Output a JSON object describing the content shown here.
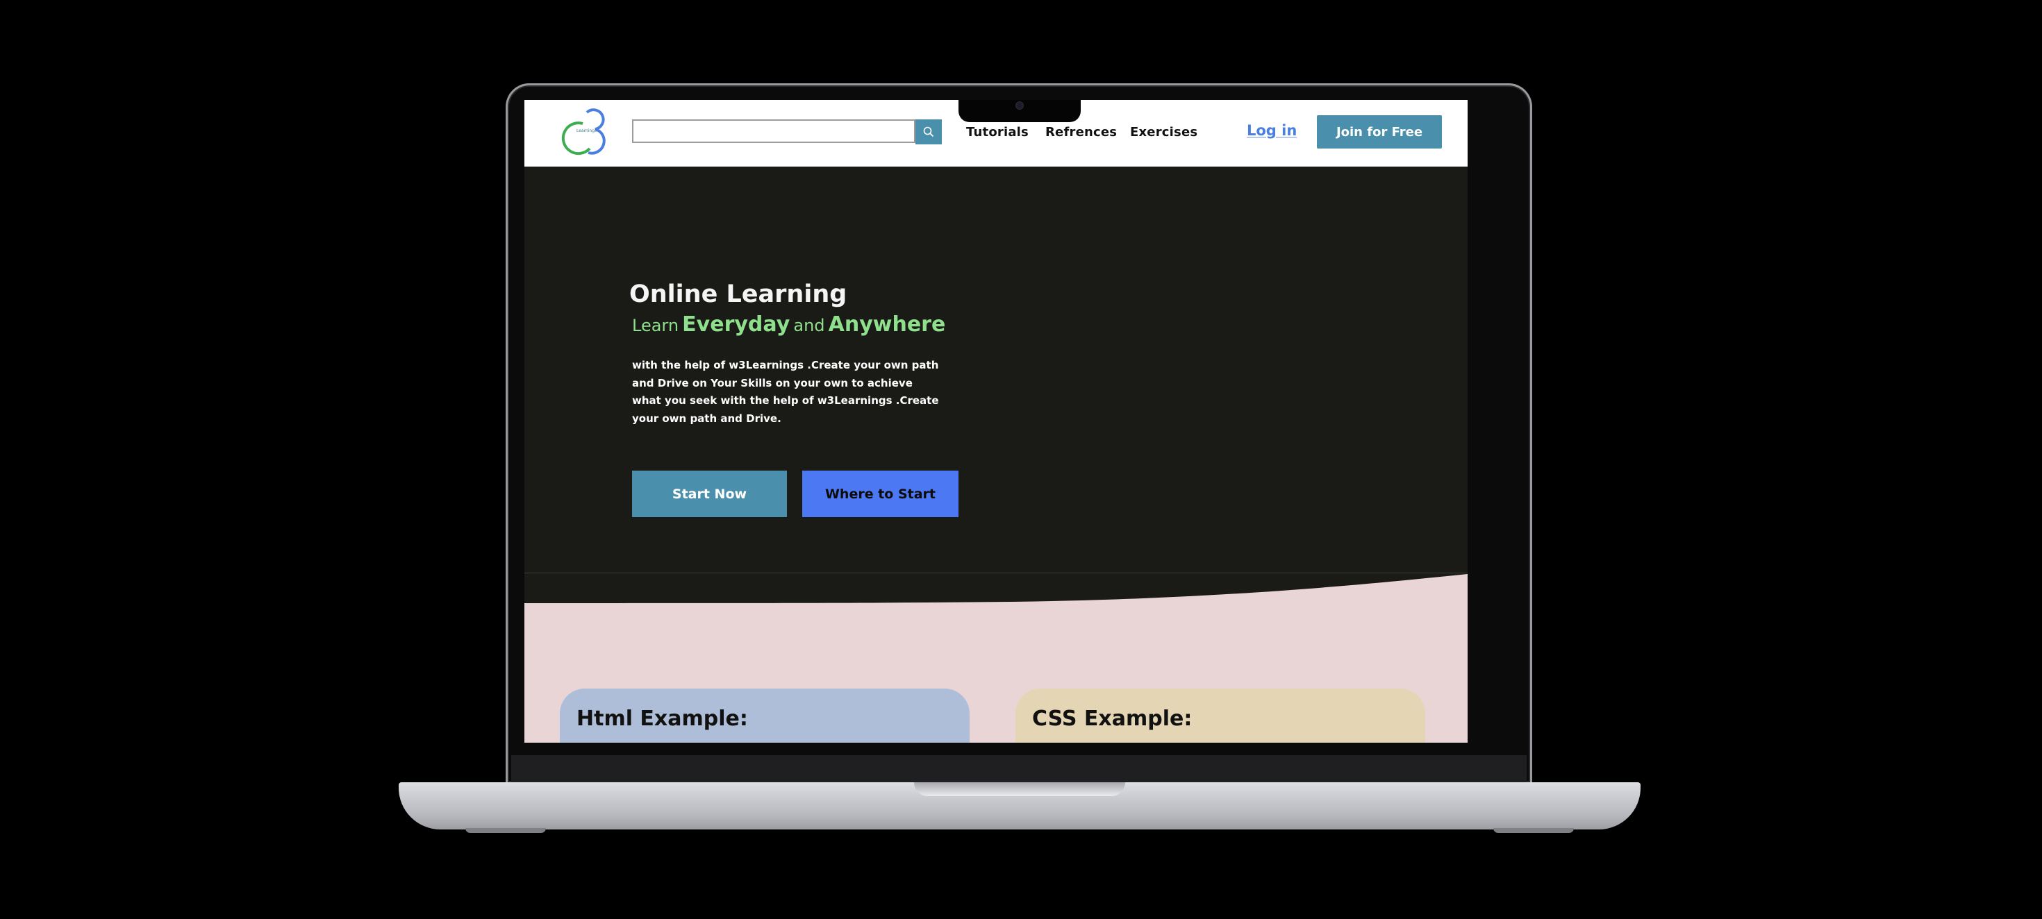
{
  "navbar": {
    "search": {
      "value": "",
      "placeholder": ""
    },
    "links": [
      "Tutorials",
      "Refrences",
      "Exercises"
    ],
    "login_label": "Log in",
    "join_label": "Join for Free"
  },
  "hero": {
    "title": "Online Learning",
    "tagline": {
      "learn": "Learn",
      "everyday": "Everyday",
      "and": "and",
      "anywhere": "Anywhere"
    },
    "description": "with the help of w3Learnings .Create your own path and Drive on Your Skills on your own to achieve what you seek with the help of w3Learnings .Create your own path and Drive.",
    "start_label": "Start Now",
    "where_label": "Where to Start"
  },
  "examples": [
    {
      "title": "Html Example:"
    },
    {
      "title": "CSS Example:"
    }
  ],
  "colors": {
    "accent": "#4a8fac",
    "secondary": "#4d78f3",
    "hero_bg": "#1a1a17",
    "tagline": "#8fe08c",
    "section_bg": "#e9d5d5",
    "card_html": "#afbed8",
    "card_css": "#e4d5b4"
  },
  "icons": {
    "search": "search-icon",
    "logo": "w3-logo-icon"
  }
}
